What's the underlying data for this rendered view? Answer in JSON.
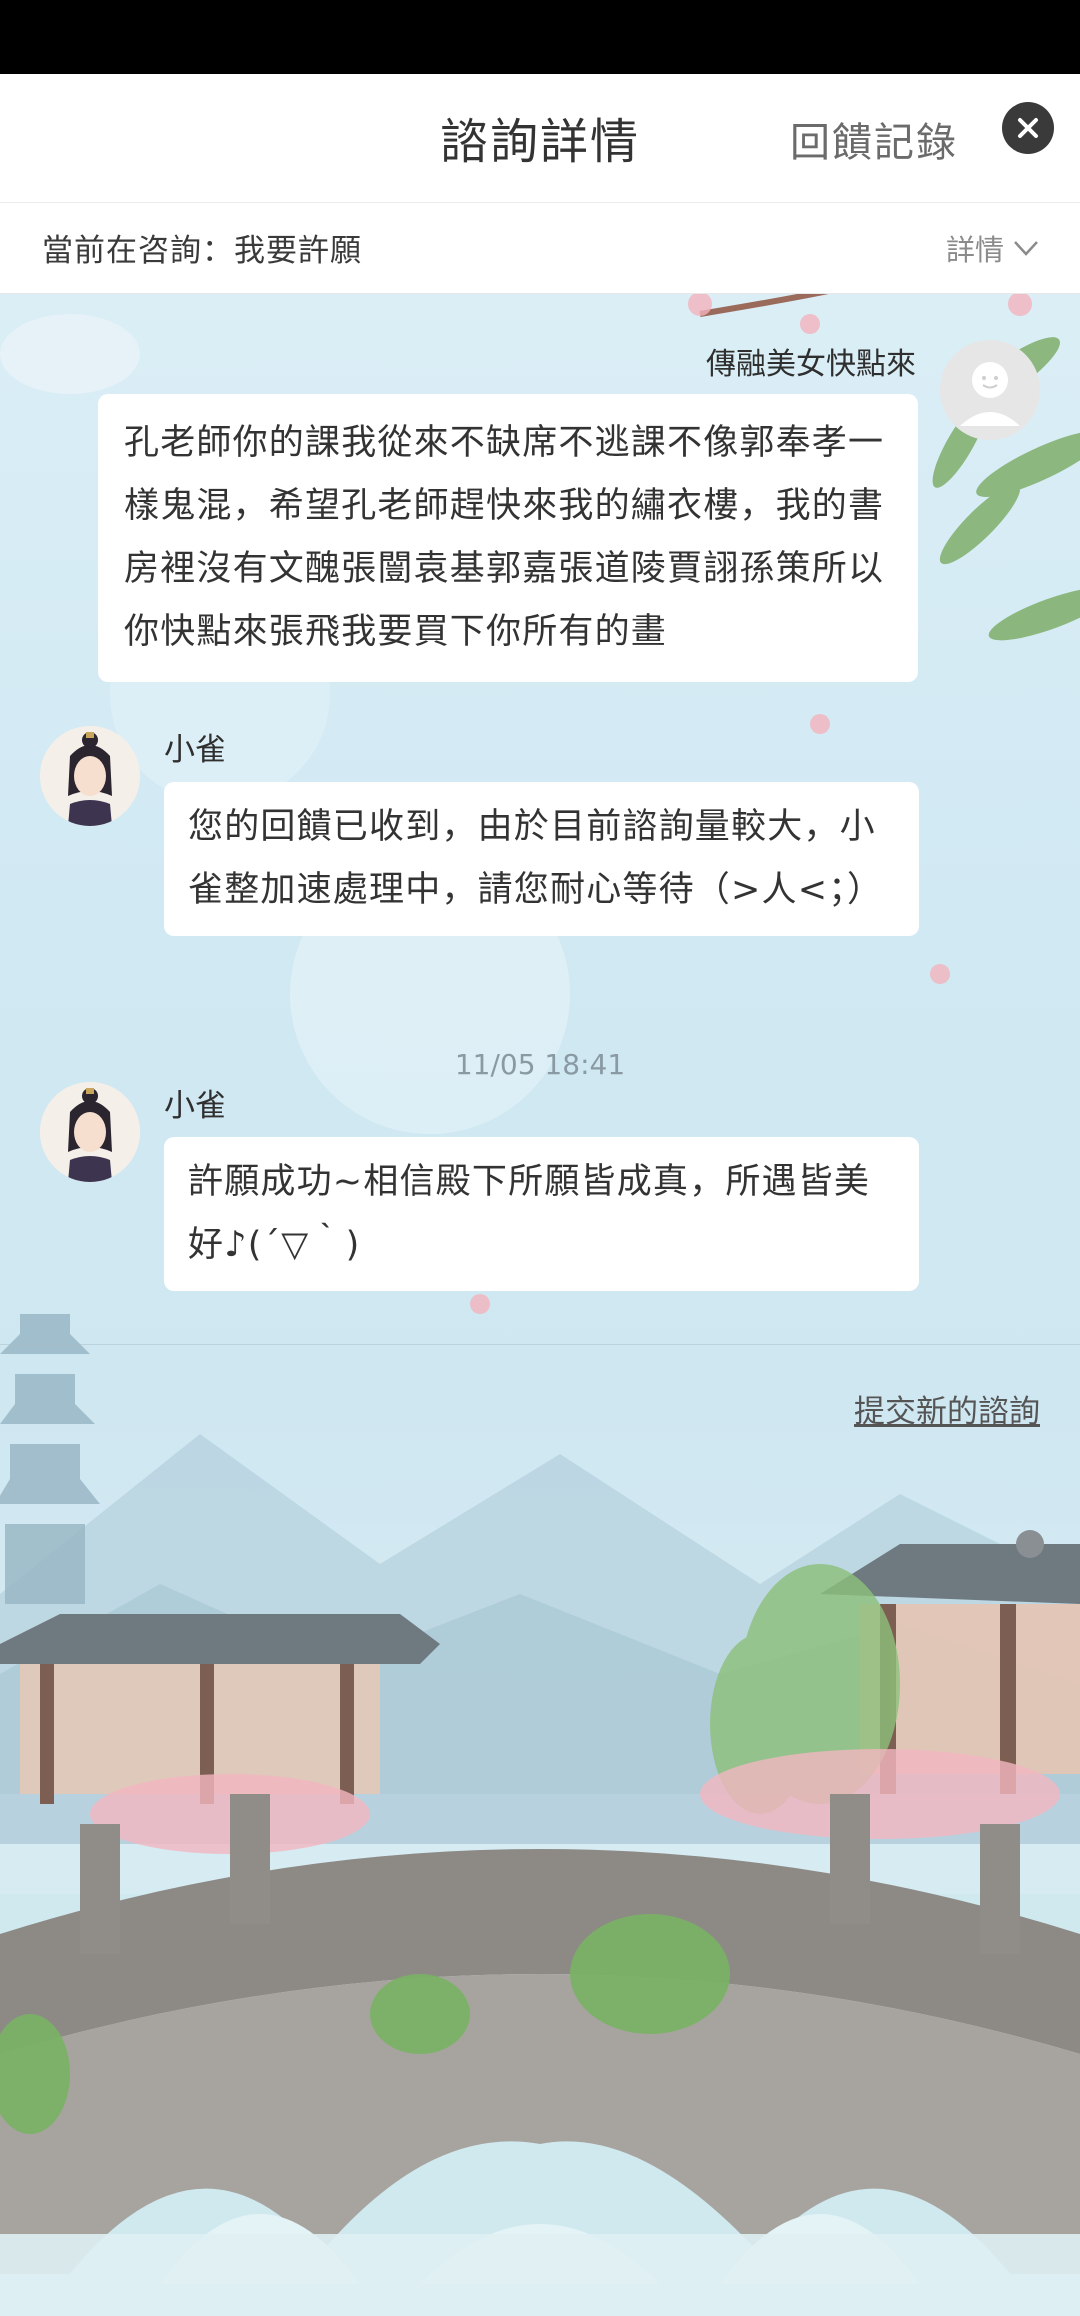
{
  "header": {
    "title": "諮詢詳情",
    "feedback_label": "回饋記錄",
    "close_label": "✕"
  },
  "subheader": {
    "topic": "當前在咨詢：我要許願",
    "detail_label": "詳情",
    "detail_icon": "chevron-down-icon"
  },
  "messages": [
    {
      "sender": "傳融美女快點來",
      "text": "孔老師你的課我從來不缺席不逃課不像郭奉孝一樣鬼混，希望孔老師趕快來我的繡衣樓，我的書房裡沒有文醜張闓袁基郭嘉張道陵賈詡孫策所以你快點來張飛我要買下你所有的畫"
    },
    {
      "sender": "小雀",
      "text": "您的回饋已收到，由於目前諮詢量較大，小雀整加速處理中，請您耐心等待（>人<；）"
    },
    {
      "timestamp": "11/05 18:41",
      "sender": "小雀",
      "text": "許願成功~相信殿下所願皆成真，所遇皆美好♪(´▽｀)"
    }
  ],
  "footer": {
    "new_consult_label": "提交新的諮詢"
  },
  "colors": {
    "header_bg": "#ffffff",
    "close_button": "#3a3a3a",
    "sky": "#d1e9f3"
  }
}
